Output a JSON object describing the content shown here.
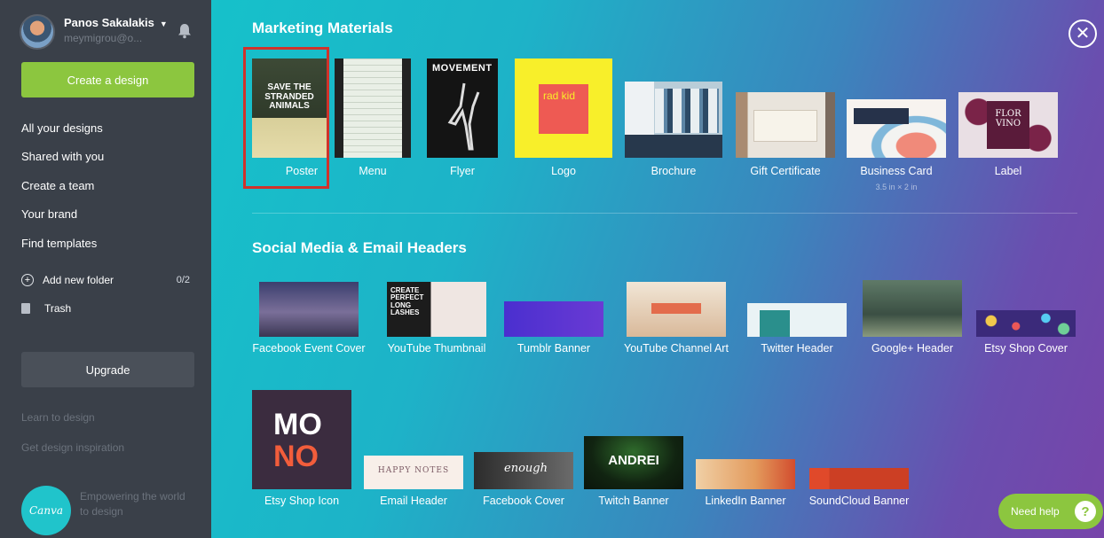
{
  "user": {
    "name": "Panos Sakalakis",
    "email": "meymigrou@o..."
  },
  "sidebar": {
    "create_label": "Create a design",
    "items": [
      {
        "label": "All your designs"
      },
      {
        "label": "Shared with you"
      },
      {
        "label": "Create a team"
      },
      {
        "label": "Your brand"
      },
      {
        "label": "Find templates"
      }
    ],
    "add_folder": {
      "label": "Add new folder",
      "count": "0/2"
    },
    "trash_label": "Trash",
    "upgrade_label": "Upgrade",
    "learn_label": "Learn to design",
    "inspiration_label": "Get design inspiration",
    "logo_text": "Canva",
    "tagline": "Empowering the world to design"
  },
  "main": {
    "marketing": {
      "title": "Marketing Materials",
      "tiles": [
        {
          "label": "Poster",
          "thumb_text": "SAVE THE STRANDED ANIMALS",
          "selected": true
        },
        {
          "label": "Menu"
        },
        {
          "label": "Flyer",
          "thumb_text": "MOVEMENT"
        },
        {
          "label": "Logo",
          "thumb_text": "rad kid"
        },
        {
          "label": "Brochure"
        },
        {
          "label": "Gift Certificate"
        },
        {
          "label": "Business Card",
          "sublabel": "3.5 in × 2 in"
        },
        {
          "label": "Label",
          "thumb_text": "FLOR VINO"
        }
      ]
    },
    "social": {
      "title": "Social Media & Email Headers",
      "tiles": [
        {
          "label": "Facebook Event Cover"
        },
        {
          "label": "YouTube Thumbnail",
          "thumb_text": "CREATE PERFECT LONG LASHES"
        },
        {
          "label": "Tumblr Banner"
        },
        {
          "label": "YouTube Channel Art"
        },
        {
          "label": "Twitter Header"
        },
        {
          "label": "Google+ Header"
        },
        {
          "label": "Etsy Shop Cover"
        },
        {
          "label": "Etsy Shop Icon",
          "thumb_text_1": "MO",
          "thumb_text_2": "NO"
        },
        {
          "label": "Email Header",
          "thumb_text": "HAPPY NOTES"
        },
        {
          "label": "Facebook Cover",
          "thumb_text": "enough"
        },
        {
          "label": "Twitch Banner",
          "thumb_text": "ANDREI"
        },
        {
          "label": "LinkedIn Banner"
        },
        {
          "label": "SoundCloud Banner"
        }
      ]
    },
    "help_label": "Need help",
    "help_icon_glyph": "?"
  },
  "colors": {
    "accent_green": "#8cc63f",
    "sidebar_bg": "#3a4049",
    "selected_outline": "#d0322b"
  }
}
